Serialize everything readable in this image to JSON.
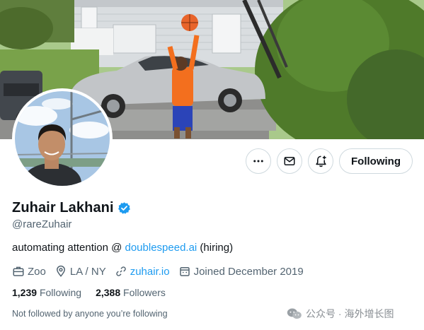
{
  "profile": {
    "name": "Zuhair Lakhani",
    "handle": "@rareZuhair",
    "bio_text": "automating attention @ ",
    "bio_link": "doublespeed.ai",
    "bio_suffix": " (hiring)",
    "work": "Zoo",
    "location": "LA / NY",
    "website": "zuhair.io",
    "joined": "Joined December 2019",
    "following_count": "1,239",
    "following_label": "Following",
    "followers_count": "2,388",
    "followers_label": "Followers",
    "not_followed_text": "Not followed by anyone you’re following"
  },
  "actions": {
    "follow_button": "Following"
  },
  "icons": {
    "more": "more-dots-icon",
    "message": "envelope-icon",
    "notify": "bell-plus-icon",
    "verified": "verified-badge-icon",
    "work": "briefcase-icon",
    "location": "location-pin-icon",
    "website": "link-icon",
    "joined": "calendar-icon"
  },
  "colors": {
    "accent": "#1d9bf0",
    "text_primary": "#0f1419",
    "text_secondary": "#536471",
    "border": "#cfd9de"
  },
  "watermark": {
    "text": "公众号 · 海外增长图"
  }
}
